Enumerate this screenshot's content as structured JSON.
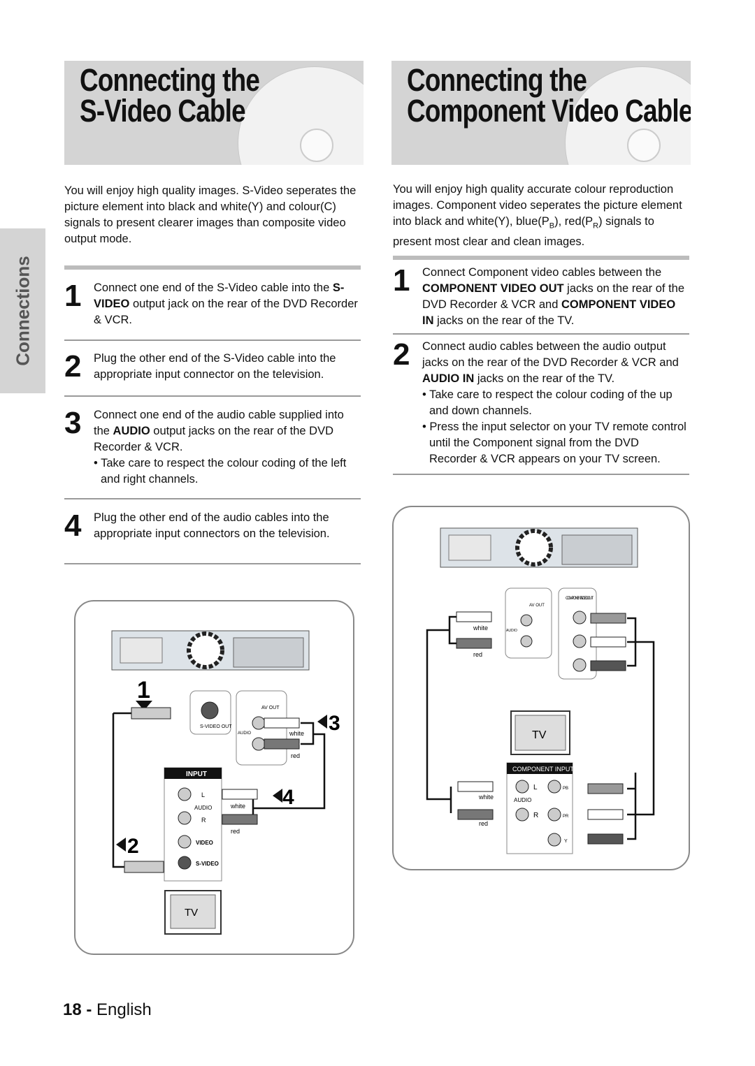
{
  "side_tab": "Connections",
  "left": {
    "title_line1": "Connecting the",
    "title_line2": "S-Video Cable",
    "intro": "You will enjoy high quality images. S-Video seperates the picture element into black and white(Y) and colour(C) signals to present clearer images than composite video output mode.",
    "steps": [
      {
        "num": "1",
        "pre": "Connect one end of the S-Video cable into the ",
        "bold": "S-VIDEO",
        "post": " output jack on the rear of the DVD Recorder & VCR."
      },
      {
        "num": "2",
        "pre": "Plug the other end of the S-Video cable into the appropriate input connector on the television.",
        "bold": "",
        "post": ""
      },
      {
        "num": "3",
        "pre": "Connect one end of the audio cable supplied into the ",
        "bold": "AUDIO",
        "post": " output jacks on the rear of the DVD Recorder & VCR.",
        "bullet": "• Take care to respect the colour coding of the left and right channels."
      },
      {
        "num": "4",
        "pre": "Plug the other end of the audio cables into the appropriate input connectors on the television.",
        "bold": "",
        "post": ""
      }
    ],
    "diagram": {
      "callouts": [
        "1",
        "2",
        "3",
        "4"
      ],
      "svideo_out": "S-VIDEO OUT",
      "av_out": "AV OUT",
      "audio": "AUDIO",
      "white": "white",
      "red": "red",
      "input": "INPUT",
      "l": "L",
      "r": "R",
      "video": "VIDEO",
      "svideo": "S-VIDEO",
      "tv": "TV"
    }
  },
  "right": {
    "title_line1": "Connecting the",
    "title_line2": "Component Video Cable",
    "intro_a": "You will enjoy high quality accurate colour reproduction images. Component video seperates the picture element into black and white(Y), blue(P",
    "intro_sub1": "B",
    "intro_b": "), red(P",
    "intro_sub2": "R",
    "intro_c": ") signals to present most clear and clean images.",
    "step1": {
      "num": "1",
      "a": "Connect Component video cables between the ",
      "b": "COMPONENT VIDEO OUT",
      "c": " jacks on the rear of the DVD Recorder & VCR and ",
      "d": "COMPONENT VIDEO IN",
      "e": " jacks on the rear of the TV."
    },
    "step2": {
      "num": "2",
      "a": "Connect audio cables between the audio output jacks on the rear of the DVD Recorder & VCR and ",
      "b": "AUDIO IN",
      "c": " jacks on the rear of the TV.",
      "bullets": [
        "• Take care to respect the colour coding of the up and down channels.",
        "• Press the input selector on your TV remote control until the Component signal from the DVD Recorder & VCR appears on your TV screen."
      ]
    },
    "diagram": {
      "av_out": "AV OUT",
      "component_video_out": "COMPONENT VIDEO OUT",
      "audio": "AUDIO",
      "white": "white",
      "red": "red",
      "tv": "TV",
      "component_input": "COMPONENT INPUT",
      "l": "L",
      "r": "R",
      "y": "Y",
      "pb": "PB",
      "pr": "PR"
    }
  },
  "footer": {
    "page": "18 -",
    "lang": "English"
  }
}
